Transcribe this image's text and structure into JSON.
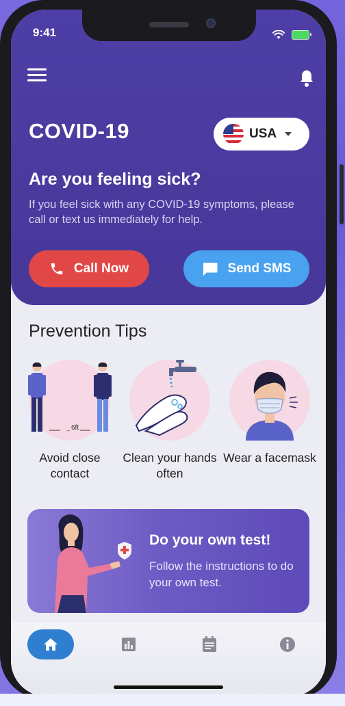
{
  "status": {
    "time": "9:41"
  },
  "header": {
    "title": "COVID-19",
    "country": "USA",
    "question": "Are you feeling sick?",
    "description": "If you feel sick with any COVID-19 symptoms, please call or text us immediately for help.",
    "call_label": "Call Now",
    "sms_label": "Send SMS"
  },
  "prevention": {
    "title": "Prevention Tips",
    "distance_label": "6ft",
    "tips": [
      {
        "label": "Avoid close contact",
        "icon": "distancing-illustration"
      },
      {
        "label": "Clean your hands often",
        "icon": "handwash-illustration"
      },
      {
        "label": "Wear a facemask",
        "icon": "facemask-illustration"
      }
    ]
  },
  "banner": {
    "title": "Do your own test!",
    "description": "Follow the instructions to do your own test."
  },
  "tabs": [
    {
      "icon": "home-icon",
      "active": true
    },
    {
      "icon": "chart-icon"
    },
    {
      "icon": "calendar-icon"
    },
    {
      "icon": "info-icon"
    }
  ],
  "colors": {
    "header": "#4b3a9e",
    "call": "#e24747",
    "sms": "#48a2ef",
    "active_tab": "#2f7fd1"
  }
}
